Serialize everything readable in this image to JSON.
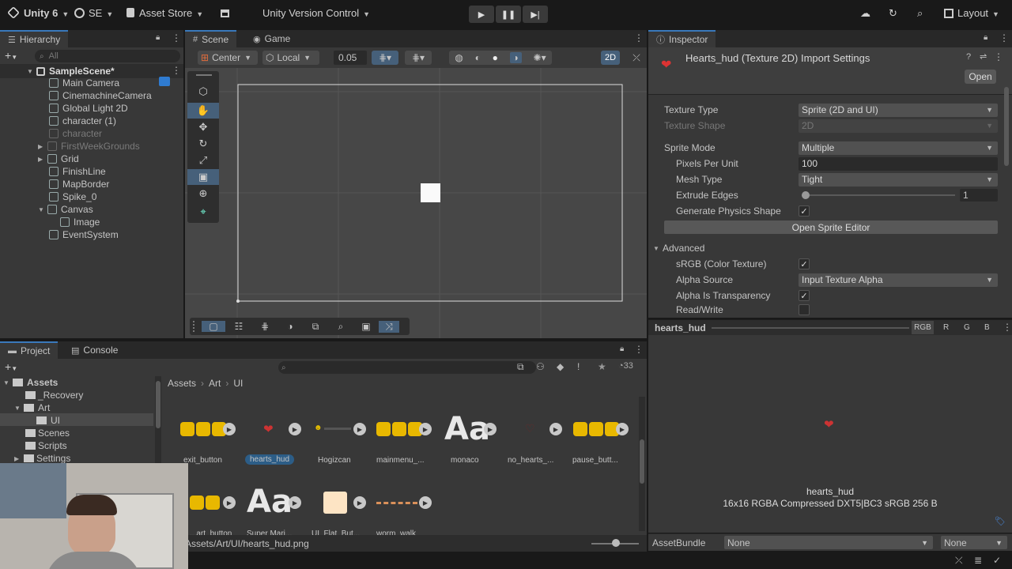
{
  "topbar": {
    "app_name": "Unity 6",
    "account": "SE",
    "asset_store": "Asset Store",
    "version_control": "Unity Version Control",
    "layout": "Layout"
  },
  "hierarchy": {
    "tab": "Hierarchy",
    "search_placeholder": "All",
    "scene": "SampleScene*",
    "items": [
      {
        "label": "Main Camera"
      },
      {
        "label": "CinemachineCamera"
      },
      {
        "label": "Global Light 2D"
      },
      {
        "label": "character (1)"
      },
      {
        "label": "character"
      },
      {
        "label": "FirstWeekGrounds"
      },
      {
        "label": "Grid"
      },
      {
        "label": "FinishLine"
      },
      {
        "label": "MapBorder"
      },
      {
        "label": "Spike_0"
      },
      {
        "label": "Canvas"
      },
      {
        "label": "Image"
      },
      {
        "label": "EventSystem"
      }
    ]
  },
  "scene": {
    "tab_scene": "Scene",
    "tab_game": "Game",
    "pivot": "Center",
    "space": "Local",
    "snap_value": "0.05",
    "mode_2d": "2D"
  },
  "inspector": {
    "tab": "Inspector",
    "title": "Hearts_hud (Texture 2D) Import Settings",
    "open_button": "Open",
    "rows": {
      "texture_type": {
        "label": "Texture Type",
        "value": "Sprite (2D and UI)"
      },
      "texture_shape": {
        "label": "Texture Shape",
        "value": "2D"
      },
      "sprite_mode": {
        "label": "Sprite Mode",
        "value": "Multiple"
      },
      "ppu": {
        "label": "Pixels Per Unit",
        "value": "100"
      },
      "mesh_type": {
        "label": "Mesh Type",
        "value": "Tight"
      },
      "extrude": {
        "label": "Extrude Edges",
        "value": "1"
      },
      "physics_shape": {
        "label": "Generate Physics Shape"
      },
      "srgb": {
        "label": "sRGB (Color Texture)"
      },
      "alpha_source": {
        "label": "Alpha Source",
        "value": "Input Texture Alpha"
      },
      "alpha_transp": {
        "label": "Alpha Is Transparency"
      },
      "read_write": {
        "label": "Read/Write"
      }
    },
    "sprite_editor_button": "Open Sprite Editor",
    "advanced": "Advanced",
    "preview": {
      "name": "hearts_hud",
      "channels": [
        "RGB",
        "R",
        "G",
        "B"
      ],
      "caption_name": "hearts_hud",
      "caption_info": "16x16  RGBA Compressed DXT5|BC3 sRGB   256 B"
    },
    "asset_bundle": {
      "label": "AssetBundle",
      "value": "None",
      "variant": "None"
    }
  },
  "project": {
    "tab_project": "Project",
    "tab_console": "Console",
    "hidden_count": "33",
    "tree": [
      {
        "label": "Assets"
      },
      {
        "label": "_Recovery"
      },
      {
        "label": "Art"
      },
      {
        "label": "UI"
      },
      {
        "label": "Scenes"
      },
      {
        "label": "Scripts"
      },
      {
        "label": "Settings"
      }
    ],
    "breadcrumb": [
      "Assets",
      "Art",
      "UI"
    ],
    "assets_row1": [
      "exit_button",
      "hearts_hud",
      "Hogizcan",
      "mainmenu_...",
      "monaco",
      "no_hearts_...",
      "pause_butt..."
    ],
    "assets_row2": [
      "...art_button",
      "Super Mari...",
      "UI_Flat_But...",
      "worm_walk"
    ],
    "big_font_glyph": "Aa",
    "status_path": "Assets/Art/UI/hearts_hud.png"
  },
  "colors": {
    "accent": "#3a79bb",
    "panel": "#383838",
    "selection": "#2c5d87"
  }
}
